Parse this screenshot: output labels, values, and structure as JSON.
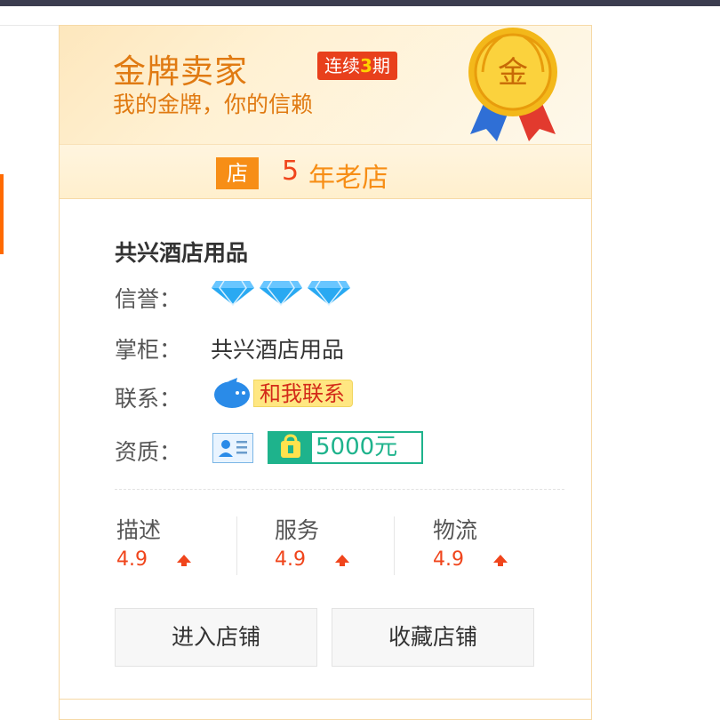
{
  "header": {
    "title": "金牌卖家",
    "badge_prefix": "连续",
    "badge_num": "3",
    "badge_suffix": "期",
    "subtitle": "我的金牌，你的信赖",
    "medal_char": "金"
  },
  "years": {
    "icon_char": "店",
    "num": "5",
    "text": " 年老店"
  },
  "shop": {
    "name": "共兴酒店用品",
    "credit_label": "信誉：",
    "credit_diamonds": 3,
    "keeper_label": "掌柜：",
    "keeper_value": "共兴酒店用品",
    "contact_label": "联系：",
    "contact_button": "和我联系",
    "qual_label": "资质：",
    "deposit": "5000元"
  },
  "scores": [
    {
      "label": "描述",
      "value": "4.9"
    },
    {
      "label": "服务",
      "value": "4.9"
    },
    {
      "label": "物流",
      "value": "4.9"
    }
  ],
  "buttons": {
    "enter": "进入店铺",
    "favorite": "收藏店铺"
  },
  "colors": {
    "orange": "#f78e16",
    "red": "#f0451c",
    "gold_text": "#e07a12",
    "deposit_green": "#1eb38c",
    "diamond_blue": "#29a9f2"
  }
}
